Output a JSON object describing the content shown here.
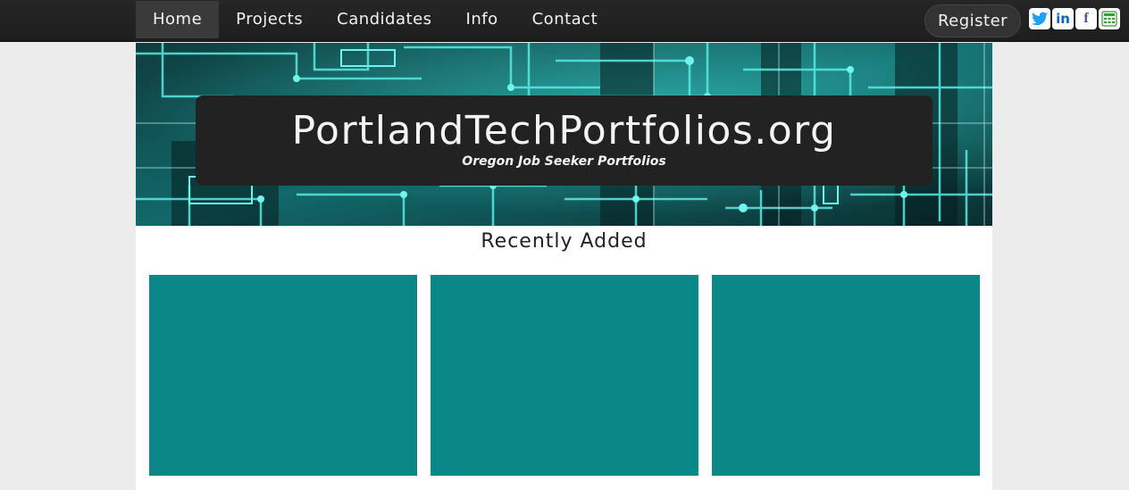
{
  "nav": {
    "items": [
      {
        "label": "Home",
        "active": true
      },
      {
        "label": "Projects",
        "active": false
      },
      {
        "label": "Candidates",
        "active": false
      },
      {
        "label": "Info",
        "active": false
      },
      {
        "label": "Contact",
        "active": false
      }
    ]
  },
  "header": {
    "register_label": "Register",
    "social": [
      {
        "icon": "twitter-icon",
        "glyph": "🐦",
        "color": "#1da1f2"
      },
      {
        "icon": "linkedin-icon",
        "glyph": "in",
        "color": "#0a66c2"
      },
      {
        "icon": "facebook-icon",
        "glyph": "f",
        "color": "#3b5998"
      },
      {
        "icon": "calculator-icon",
        "glyph": "▦",
        "color": "#3c9a3c"
      }
    ]
  },
  "hero": {
    "title": "PortlandTechPortfolios.org",
    "tagline": "Oregon Job Seeker Portfolios"
  },
  "main": {
    "section_title": "Recently Added",
    "card_color": "#098887",
    "cards": [
      {},
      {},
      {}
    ]
  },
  "colors": {
    "accent": "#098887",
    "hero_cyan": "#3fd8d0"
  }
}
